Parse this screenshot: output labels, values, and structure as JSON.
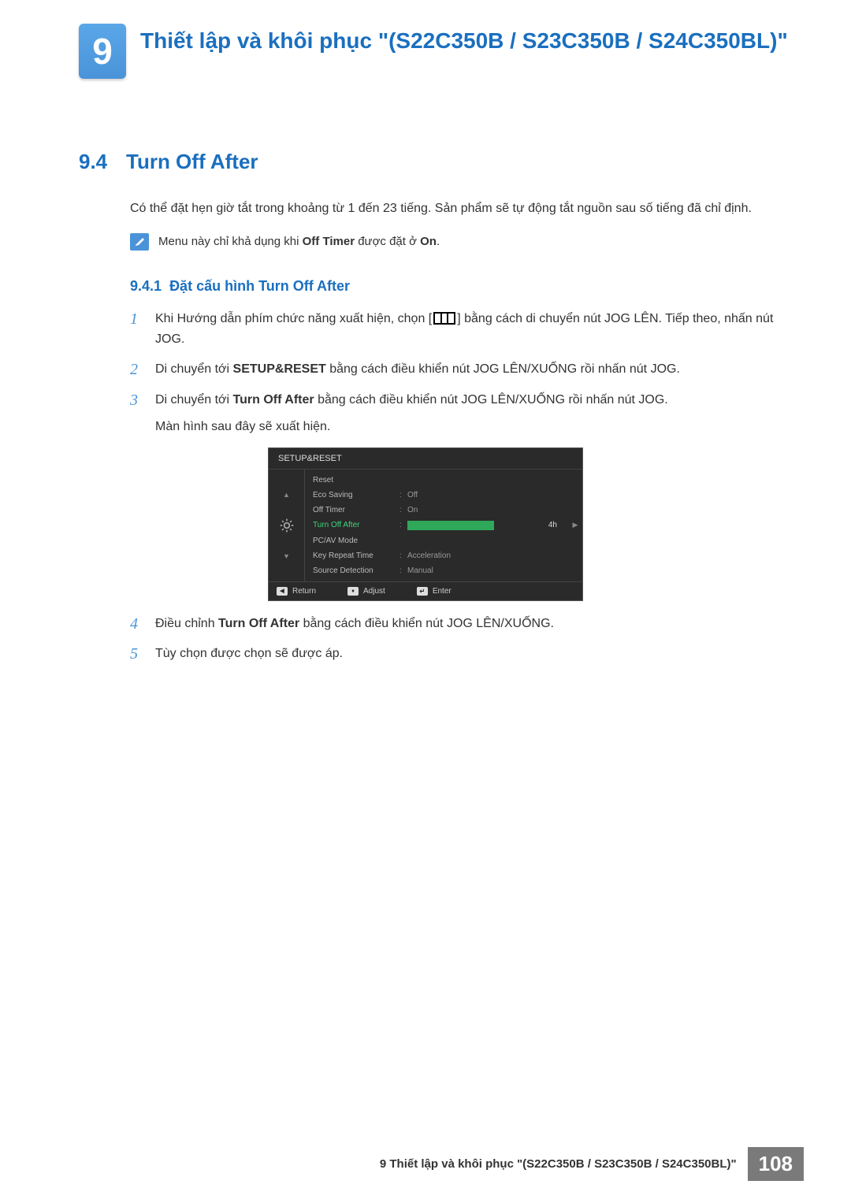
{
  "chapter": {
    "number": "9",
    "title": "Thiết lập và khôi phục \"(S22C350B / S23C350B / S24C350BL)\""
  },
  "section": {
    "number": "9.4",
    "title": "Turn Off After",
    "body": "Có thể đặt hẹn giờ tắt trong khoảng từ 1 đến 23 tiếng. Sản phẩm sẽ tự động tắt nguồn sau số tiếng đã chỉ định."
  },
  "note": {
    "prefix": "Menu này chỉ khả dụng khi ",
    "bold1": "Off Timer",
    "mid": " được đặt ở ",
    "bold2": "On",
    "suffix": "."
  },
  "subsection": {
    "number": "9.4.1",
    "title": "Đặt cấu hình Turn Off After"
  },
  "steps": {
    "s1": {
      "a": "Khi Hướng dẫn phím chức năng xuất hiện, chọn [",
      "b": "] bằng cách di chuyển nút JOG LÊN. Tiếp theo, nhấn nút JOG."
    },
    "s2": {
      "a": "Di chuyển tới ",
      "bold": "SETUP&RESET",
      "b": " bằng cách điều khiển nút JOG LÊN/XUỐNG rồi nhấn nút JOG."
    },
    "s3": {
      "a": "Di chuyển tới ",
      "bold": "Turn Off After",
      "b": " bằng cách điều khiển nút JOG LÊN/XUỐNG rồi nhấn nút JOG.",
      "sub": "Màn hình sau đây sẽ xuất hiện."
    },
    "s4": {
      "a": "Điều chỉnh ",
      "bold": "Turn Off After",
      "b": " bằng cách điều khiển nút JOG LÊN/XUỐNG."
    },
    "s5": {
      "a": "Tùy chọn được chọn sẽ được áp."
    }
  },
  "osd": {
    "title": "SETUP&RESET",
    "items": {
      "reset": "Reset",
      "eco": "Eco Saving",
      "eco_val": "Off",
      "offtimer": "Off Timer",
      "offtimer_val": "On",
      "turnoff": "Turn Off After",
      "turnoff_val": "4h",
      "pcav": "PC/AV Mode",
      "keyrepeat": "Key Repeat Time",
      "keyrepeat_val": "Acceleration",
      "source": "Source Detection",
      "source_val": "Manual"
    },
    "footer": {
      "return": "Return",
      "adjust": "Adjust",
      "enter": "Enter"
    }
  },
  "footer": {
    "text": "9 Thiết lập và khôi phục \"(S22C350B / S23C350B / S24C350BL)\"",
    "page": "108"
  }
}
